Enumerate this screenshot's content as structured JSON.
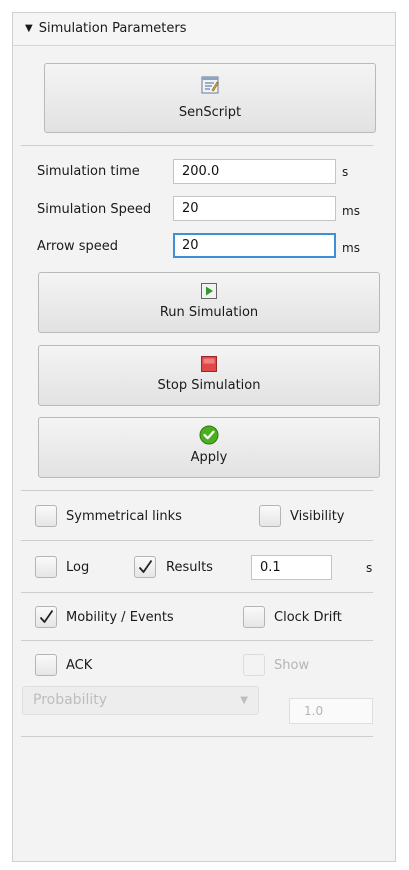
{
  "panel": {
    "title": "Simulation Parameters"
  },
  "senscript": {
    "label": "SenScript",
    "icon": "script-editor-icon"
  },
  "params": {
    "sim_time": {
      "label": "Simulation time",
      "value": "200.0",
      "unit": "s"
    },
    "sim_speed": {
      "label": "Simulation Speed",
      "value": "20",
      "unit": "ms"
    },
    "arrow_speed": {
      "label": "Arrow speed",
      "value": "20",
      "unit": "ms"
    }
  },
  "buttons": {
    "run": {
      "label": "Run Simulation",
      "icon": "play-icon"
    },
    "stop": {
      "label": "Stop Simulation",
      "icon": "stop-icon"
    },
    "apply": {
      "label": "Apply",
      "icon": "check-circle-icon"
    }
  },
  "options": {
    "symmetrical_links": {
      "label": "Symmetrical links",
      "checked": false
    },
    "visibility": {
      "label": "Visibility",
      "checked": false
    },
    "log": {
      "label": "Log",
      "checked": false
    },
    "results": {
      "label": "Results",
      "checked": true
    },
    "results_value": "0.1",
    "results_unit": "s",
    "mobility_events": {
      "label": "Mobility / Events",
      "checked": true
    },
    "clock_drift": {
      "label": "Clock Drift",
      "checked": false
    },
    "ack": {
      "label": "ACK",
      "checked": false
    },
    "show": {
      "label": "Show",
      "checked": false,
      "enabled": false
    }
  },
  "ack_config": {
    "mode_selected": "Probability",
    "probability_value": "1.0"
  },
  "colors": {
    "focus": "#3d8fd6",
    "play_green": "#2e9b2e",
    "stop_red": "#e04848",
    "apply_green": "#4caf1f"
  }
}
